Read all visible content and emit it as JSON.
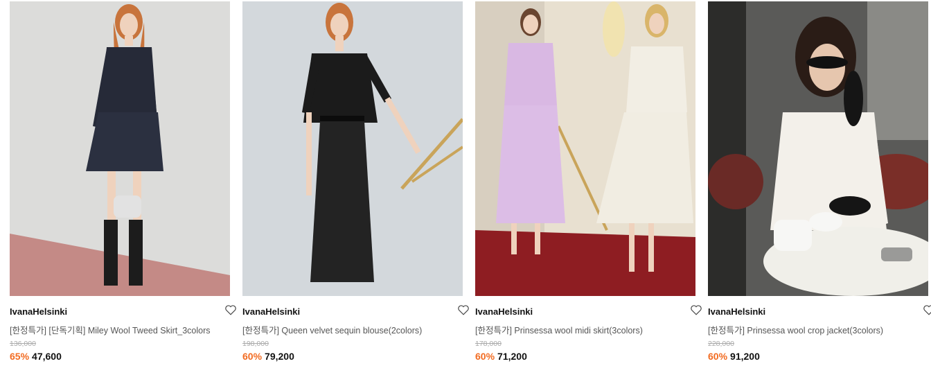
{
  "colors": {
    "discount": "#f26b21",
    "text": "#111111",
    "muted": "#aaaaaa"
  },
  "products": [
    {
      "brand": "IvanaHelsinki",
      "name": "[한정특가] [단독기획] Miley Wool Tweed Skirt_3colors",
      "original_price": "136,000",
      "discount": "65%",
      "price": "47,600",
      "icon": "heart-outline-icon"
    },
    {
      "brand": "IvanaHelsinki",
      "name": "[한정특가] Queen velvet sequin blouse(2colors)",
      "original_price": "198,000",
      "discount": "60%",
      "price": "79,200",
      "icon": "heart-outline-icon"
    },
    {
      "brand": "IvanaHelsinki",
      "name": "[한정특가] Prinsessa wool midi skirt(3colors)",
      "original_price": "178,000",
      "discount": "60%",
      "price": "71,200",
      "icon": "heart-outline-icon"
    },
    {
      "brand": "IvanaHelsinki",
      "name": "[한정특가] Prinsessa wool crop jacket(3colors)",
      "original_price": "228,000",
      "discount": "60%",
      "price": "91,200",
      "icon": "heart-outline-icon"
    }
  ]
}
